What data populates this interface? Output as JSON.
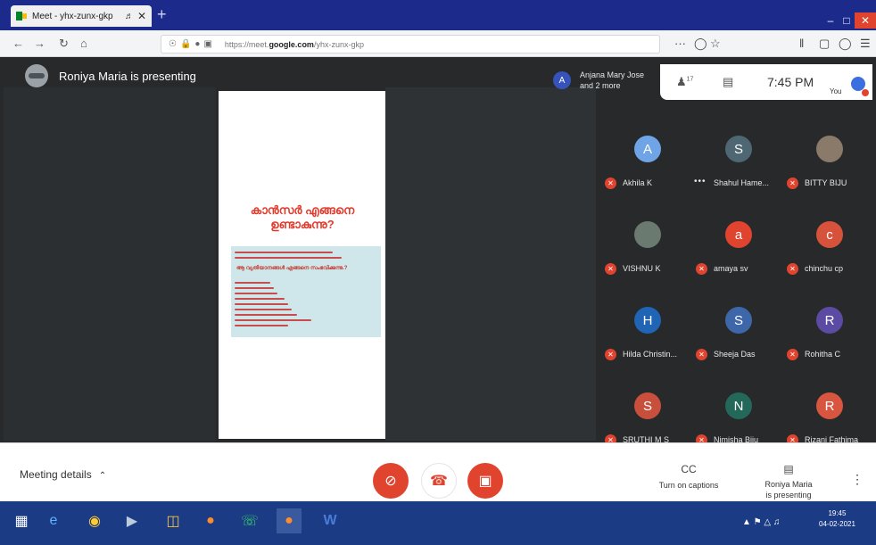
{
  "browser": {
    "tab_title": "Meet - yhx-zunx-gkp",
    "audio_icon": "speaker-icon",
    "new_tab": "+",
    "url_prefix": "https://meet.",
    "url_domain": "google.com",
    "url_path": "/yhx-zunx-gkp",
    "menu_dots": "···"
  },
  "meet": {
    "presenter_status": "Roniya Maria is presenting",
    "slide": {
      "heading_line1": "കാൻസർ എങ്ങനെ",
      "heading_line2": "ഉണ്ടാകുന്നു?",
      "subheading": "ആ വ്യതിയാനങ്ങൾ എങ്ങനെ സംഭവിക്കുന്നു.?"
    },
    "joined_avatar_letter": "A",
    "joined_line1": "Anjana Mary Jose",
    "joined_line2": "and 2 more",
    "participants_count": "17",
    "time": "7:45 PM",
    "you_label": "You",
    "participants": [
      {
        "name": "Akhila K",
        "initial": "A",
        "color": "#6fa5e6"
      },
      {
        "name": "Shahul Hame...",
        "initial": "S",
        "color": "#4e6773"
      },
      {
        "name": "BITTY BIJU",
        "initial": "",
        "color": "#8a7a6a"
      },
      {
        "name": "VISHNU K",
        "initial": "",
        "color": "#6a7a70"
      },
      {
        "name": "amaya sv",
        "initial": "a",
        "color": "#e0442f"
      },
      {
        "name": "chinchu cp",
        "initial": "c",
        "color": "#d6523a"
      },
      {
        "name": "Hilda Christin...",
        "initial": "H",
        "color": "#1f64b5"
      },
      {
        "name": "Sheeja Das",
        "initial": "S",
        "color": "#3d67a9"
      },
      {
        "name": "Rohitha C",
        "initial": "R",
        "color": "#5b4ba3"
      },
      {
        "name": "SRUTHI M S",
        "initial": "S",
        "color": "#c94f3d"
      },
      {
        "name": "Nimisha Biju",
        "initial": "N",
        "color": "#24685a"
      },
      {
        "name": "Rizani Fathima",
        "initial": "R",
        "color": "#d8553f"
      }
    ],
    "meeting_details": "Meeting details",
    "captions_label": "Turn on captions",
    "captions_icon": "CC",
    "presenting_line1": "Roniya Maria",
    "presenting_line2": "is presenting"
  },
  "taskbar": {
    "clock_time": "19:45",
    "clock_date": "04-02-2021"
  },
  "colors": {
    "tabbar": "#1c2a8c",
    "stage": "#27292b",
    "danger": "#e0442f",
    "taskbar": "#1b3c84"
  }
}
